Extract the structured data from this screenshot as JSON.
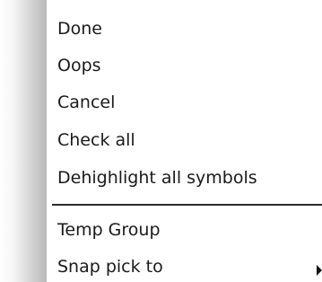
{
  "menu": {
    "items": [
      {
        "label": "Done"
      },
      {
        "label": "Oops"
      },
      {
        "label": "Cancel"
      },
      {
        "label": "Check all"
      },
      {
        "label": "Dehighlight all symbols"
      },
      {
        "label": "Temp Group"
      },
      {
        "label": "Snap pick to",
        "submenu_icon": "submenu-arrow-icon"
      }
    ]
  }
}
